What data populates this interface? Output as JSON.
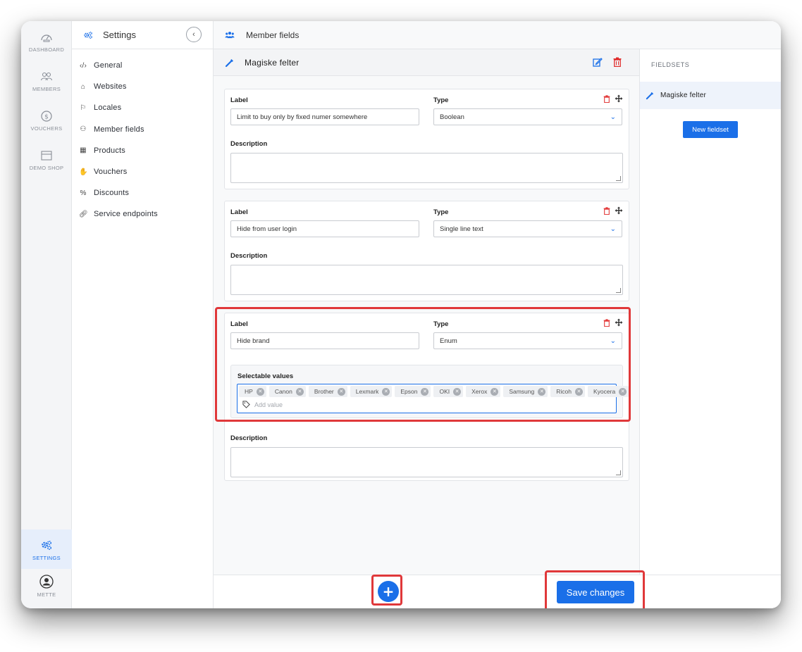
{
  "rail": {
    "items": [
      {
        "label": "DASHBOARD",
        "icon": "gauge-icon"
      },
      {
        "label": "MEMBERS",
        "icon": "members-icon"
      },
      {
        "label": "VOUCHERS",
        "icon": "voucher-icon"
      },
      {
        "label": "DEMO SHOP",
        "icon": "shop-icon"
      }
    ],
    "settings_label": "SETTINGS",
    "user_label": "METTE"
  },
  "nav": {
    "title": "Settings",
    "items": [
      {
        "label": "General",
        "icon": "code-icon"
      },
      {
        "label": "Websites",
        "icon": "home-icon"
      },
      {
        "label": "Locales",
        "icon": "flag-icon"
      },
      {
        "label": "Member fields",
        "icon": "members-icon"
      },
      {
        "label": "Products",
        "icon": "boxes-icon"
      },
      {
        "label": "Vouchers",
        "icon": "hand-coin-icon"
      },
      {
        "label": "Discounts",
        "icon": "percent-icon"
      },
      {
        "label": "Service endpoints",
        "icon": "link-icon"
      }
    ]
  },
  "main": {
    "title": "Member fields",
    "fieldset_title": "Magiske felter"
  },
  "fields": [
    {
      "label_caption": "Label",
      "label_value": "Limit to buy only by fixed numer somewhere",
      "type_caption": "Type",
      "type_value": "Boolean",
      "description_caption": "Description"
    },
    {
      "label_caption": "Label",
      "label_value": "Hide from user login",
      "type_caption": "Type",
      "type_value": "Single line text",
      "description_caption": "Description"
    },
    {
      "label_caption": "Label",
      "label_value": "Hide brand",
      "type_caption": "Type",
      "type_value": "Enum",
      "description_caption": "Description",
      "selectable_caption": "Selectable values",
      "values": [
        "HP",
        "Canon",
        "Brother",
        "Lexmark",
        "Epson",
        "OKI",
        "Xerox",
        "Samsung",
        "Ricoh",
        "Kyocera"
      ],
      "add_placeholder": "Add value"
    }
  ],
  "fieldsets": {
    "caption": "FIELDSETS",
    "items": [
      "Magiske felter"
    ],
    "new_button": "New fieldset"
  },
  "footer": {
    "add_label": "+",
    "save_label": "Save changes"
  },
  "colors": {
    "accent": "#1a6fe8",
    "danger": "#e02b2b",
    "highlight": "#e0383a"
  }
}
